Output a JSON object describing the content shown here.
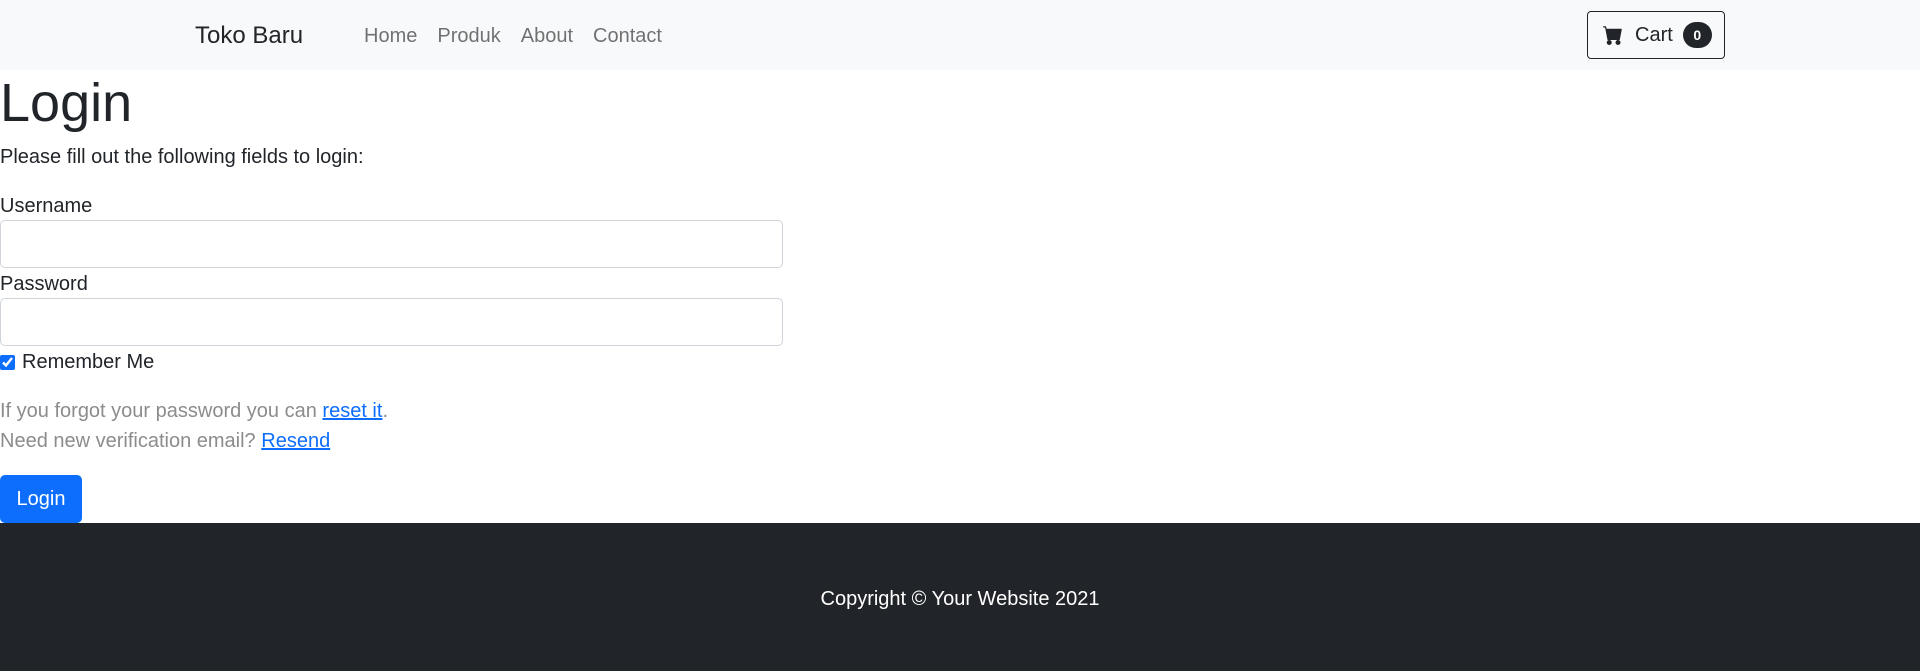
{
  "navbar": {
    "brand": "Toko Baru",
    "links": [
      "Home",
      "Produk",
      "About",
      "Contact"
    ],
    "cart_label": "Cart",
    "cart_count": "0"
  },
  "main": {
    "title": "Login",
    "instructions": "Please fill out the following fields to login:",
    "username_label": "Username",
    "username_value": "",
    "password_label": "Password",
    "password_value": "",
    "remember_label": "Remember Me",
    "remember_checked": true,
    "forgot_text": "If you forgot your password you can ",
    "forgot_link": "reset it",
    "forgot_suffix": ".",
    "resend_text": "Need new verification email? ",
    "resend_link": "Resend",
    "login_button": "Login"
  },
  "footer": {
    "copyright": "Copyright © Your Website 2021"
  },
  "colors": {
    "primary": "#0d6efd",
    "navbar_bg": "#f8f9fa",
    "footer_bg": "#212529"
  },
  "icons": {
    "cart": "shopping-cart-icon"
  }
}
